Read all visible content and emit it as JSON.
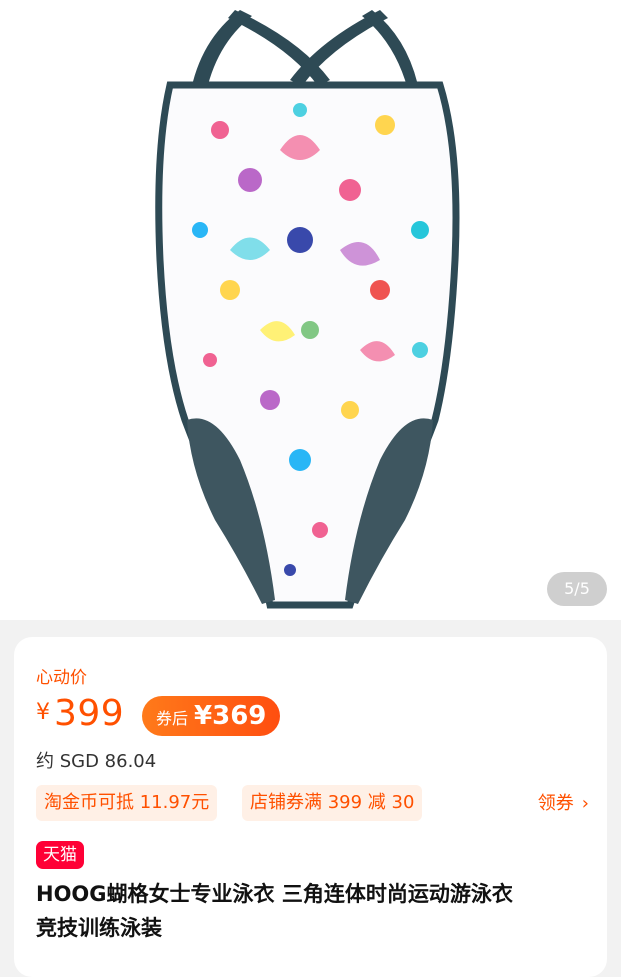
{
  "gallery": {
    "image_alt": "swimsuit-product-image",
    "page_indicator": "5/5"
  },
  "price": {
    "label": "心动价",
    "currency": "¥",
    "original": "399",
    "coupon_tag": "券后",
    "coupon_price": "¥369",
    "approx": "约 SGD 86.04"
  },
  "promotions": [
    {
      "text": "淘金币可抵 11.97元"
    },
    {
      "text": "店铺券满 399 减 30"
    }
  ],
  "coupon_link": {
    "label": "领券",
    "icon": "chevron-right-icon"
  },
  "badge": {
    "label": "天猫"
  },
  "product": {
    "title_line1": "HOOG蝴格女士专业泳衣 三角连体时尚运动游泳衣",
    "title_line2": "竞技训练泳装"
  },
  "colors": {
    "accent": "#ff5000",
    "tmall": "#ff0036",
    "swimsuit_trim": "#2e4a55"
  }
}
